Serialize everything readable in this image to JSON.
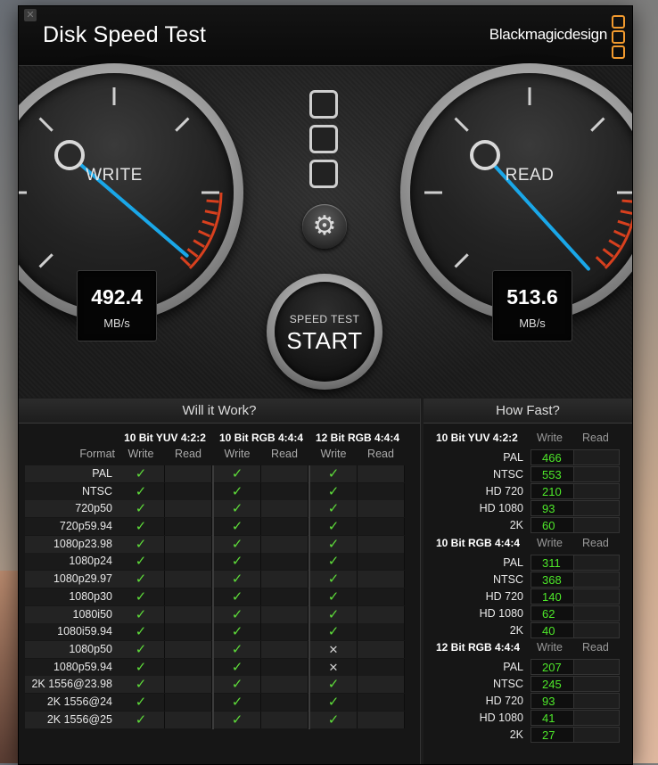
{
  "window": {
    "title": "Disk Speed Test",
    "brand": "Blackmagicdesign",
    "close_glyph": "✕"
  },
  "colors": {
    "accent": "#f29a2e",
    "needle": "#1aa7e8",
    "pass": "#5edc3a",
    "speed_value": "#4ee82a",
    "redline": "#d8401e"
  },
  "gauges": {
    "write": {
      "label": "WRITE",
      "value": "492.4",
      "unit": "MB/s"
    },
    "read": {
      "label": "READ",
      "value": "513.6",
      "unit": "MB/s"
    }
  },
  "controls": {
    "settings_icon": "gear-icon",
    "start_top": "SPEED TEST",
    "start_main": "START"
  },
  "will_it_work": {
    "title": "Will it Work?",
    "format_label": "Format",
    "groups": [
      "10 Bit YUV 4:2:2",
      "10 Bit RGB 4:4:4",
      "12 Bit RGB 4:4:4"
    ],
    "write_label": "Write",
    "read_label": "Read",
    "rows": [
      {
        "format": "PAL",
        "marks": [
          "✓",
          "✓",
          "✓"
        ]
      },
      {
        "format": "NTSC",
        "marks": [
          "✓",
          "✓",
          "✓"
        ]
      },
      {
        "format": "720p50",
        "marks": [
          "✓",
          "✓",
          "✓"
        ]
      },
      {
        "format": "720p59.94",
        "marks": [
          "✓",
          "✓",
          "✓"
        ]
      },
      {
        "format": "1080p23.98",
        "marks": [
          "✓",
          "✓",
          "✓"
        ]
      },
      {
        "format": "1080p24",
        "marks": [
          "✓",
          "✓",
          "✓"
        ]
      },
      {
        "format": "1080p29.97",
        "marks": [
          "✓",
          "✓",
          "✓"
        ]
      },
      {
        "format": "1080p30",
        "marks": [
          "✓",
          "✓",
          "✓"
        ]
      },
      {
        "format": "1080i50",
        "marks": [
          "✓",
          "✓",
          "✓"
        ]
      },
      {
        "format": "1080i59.94",
        "marks": [
          "✓",
          "✓",
          "✓"
        ]
      },
      {
        "format": "1080p50",
        "marks": [
          "✓",
          "✓",
          "✕"
        ]
      },
      {
        "format": "1080p59.94",
        "marks": [
          "✓",
          "✓",
          "✕"
        ]
      },
      {
        "format": "2K 1556@23.98",
        "marks": [
          "✓",
          "✓",
          "✓"
        ]
      },
      {
        "format": "2K 1556@24",
        "marks": [
          "✓",
          "✓",
          "✓"
        ]
      },
      {
        "format": "2K 1556@25",
        "marks": [
          "✓",
          "✓",
          "✓"
        ]
      }
    ]
  },
  "how_fast": {
    "title": "How Fast?",
    "write_label": "Write",
    "read_label": "Read",
    "groups": [
      {
        "name": "10 Bit YUV 4:2:2",
        "rows": [
          {
            "format": "PAL",
            "write": "466"
          },
          {
            "format": "NTSC",
            "write": "553"
          },
          {
            "format": "HD 720",
            "write": "210"
          },
          {
            "format": "HD 1080",
            "write": "93"
          },
          {
            "format": "2K",
            "write": "60"
          }
        ]
      },
      {
        "name": "10 Bit RGB 4:4:4",
        "rows": [
          {
            "format": "PAL",
            "write": "311"
          },
          {
            "format": "NTSC",
            "write": "368"
          },
          {
            "format": "HD 720",
            "write": "140"
          },
          {
            "format": "HD 1080",
            "write": "62"
          },
          {
            "format": "2K",
            "write": "40"
          }
        ]
      },
      {
        "name": "12 Bit RGB 4:4:4",
        "rows": [
          {
            "format": "PAL",
            "write": "207"
          },
          {
            "format": "NTSC",
            "write": "245"
          },
          {
            "format": "HD 720",
            "write": "93"
          },
          {
            "format": "HD 1080",
            "write": "41"
          },
          {
            "format": "2K",
            "write": "27"
          }
        ]
      }
    ]
  }
}
